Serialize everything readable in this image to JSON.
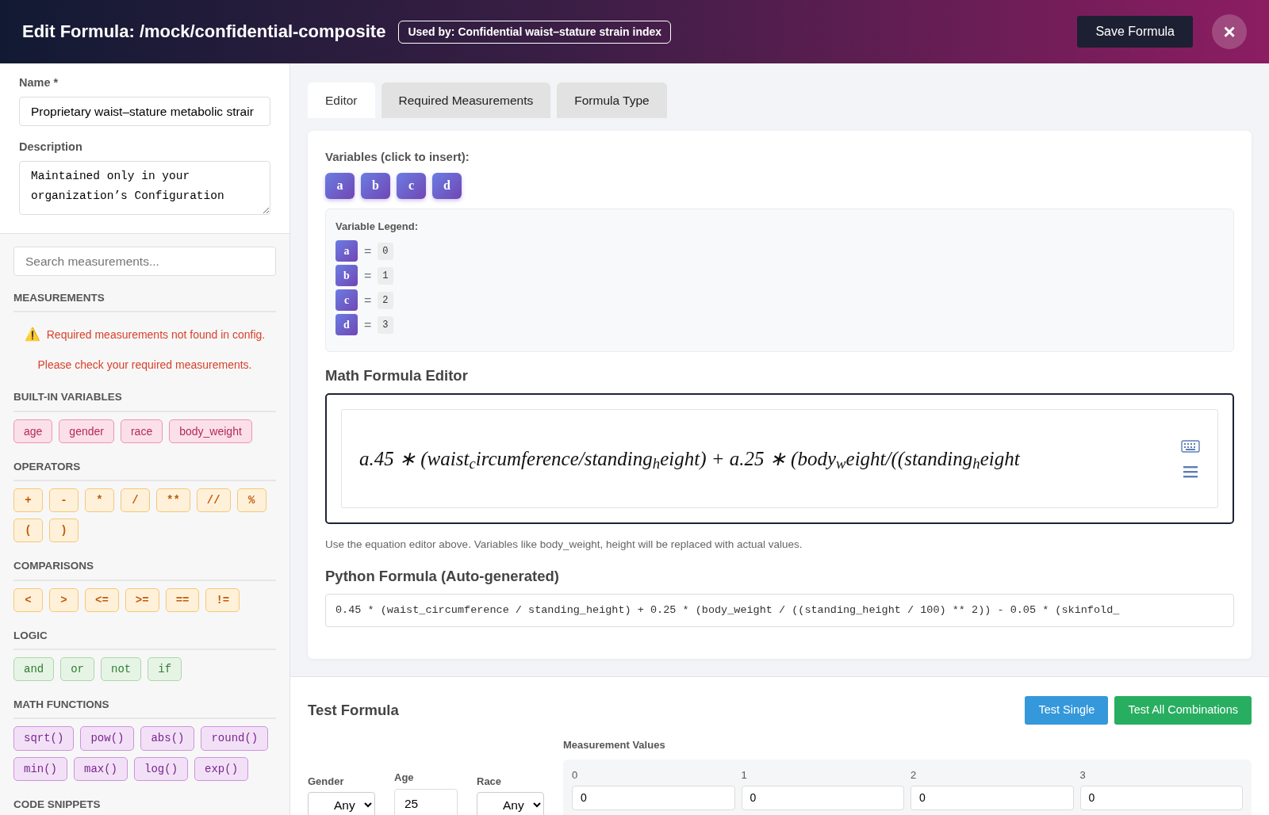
{
  "header": {
    "title": "Edit Formula: /mock/confidential-composite",
    "used_by": "Used by: Confidential waist–stature strain index",
    "save_button": "Save Formula",
    "close_button": "×"
  },
  "form": {
    "name": {
      "label": "Name *",
      "value": "Proprietary waist–stature metabolic strair"
    },
    "description": {
      "label": "Description",
      "value": "Maintained only in your organization’s Configuration"
    }
  },
  "sidebar": {
    "search_placeholder": "Search measurements...",
    "sections": [
      {
        "title": "MEASUREMENTS",
        "kind": "message",
        "warning_icon": "⚠️",
        "lines": [
          "Required measurements not found in config.",
          "Please check your required measurements."
        ]
      },
      {
        "title": "BUILT-IN VARIABLES",
        "kind": "builtin",
        "items": [
          "age",
          "gender",
          "race",
          "body_weight"
        ]
      },
      {
        "title": "OPERATORS",
        "kind": "operator",
        "items": [
          "+",
          "-",
          "*",
          "/",
          "**",
          "//",
          "%",
          "(",
          ")"
        ]
      },
      {
        "title": "COMPARISONS",
        "kind": "operator",
        "items": [
          "<",
          ">",
          "<=",
          ">=",
          "==",
          "!="
        ]
      },
      {
        "title": "LOGIC",
        "kind": "logic",
        "items": [
          "and",
          "or",
          "not",
          "if"
        ]
      },
      {
        "title": "MATH FUNCTIONS",
        "kind": "function",
        "items": [
          "sqrt()",
          "pow()",
          "abs()",
          "round()",
          "min()",
          "max()",
          "log()",
          "exp()"
        ]
      },
      {
        "title": "CODE SNIPPETS",
        "kind": "heading"
      }
    ]
  },
  "tabs": [
    {
      "label": "Editor",
      "selected": true
    },
    {
      "label": "Required Measurements",
      "selected": false
    },
    {
      "label": "Formula Type",
      "selected": false
    }
  ],
  "variables": {
    "label": "Variables (click to insert):",
    "buttons": [
      "a",
      "b",
      "c",
      "d"
    ],
    "legend_title": "Variable Legend:",
    "legend": [
      {
        "var": "a",
        "equals": "=",
        "value": "0"
      },
      {
        "var": "b",
        "equals": "=",
        "value": "1"
      },
      {
        "var": "c",
        "equals": "=",
        "value": "2"
      },
      {
        "var": "d",
        "equals": "=",
        "value": "3"
      }
    ]
  },
  "math_editor": {
    "title": "Math Formula Editor",
    "formula": "a.45 ∗ (waist$_{c}$ircumference/standing$_{h}$eight) + a.25 ∗ (body$_{w}$eight/((standing$_{h}$eight",
    "help": "Use the equation editor above. Variables like body_weight, height will be replaced with actual values."
  },
  "python": {
    "title": "Python Formula (Auto-generated)",
    "formula": "0.45 * (waist_circumference / standing_height) + 0.25 * (body_weight / ((standing_height / 100) ** 2)) - 0.05 * (skinfold_"
  },
  "test": {
    "title": "Test Formula",
    "buttons": [
      {
        "label": "Test Single",
        "kind": "primary"
      },
      {
        "label": "Test All Combinations",
        "kind": "success"
      }
    ],
    "fields": [
      {
        "label": "Age",
        "kind": "input",
        "value": "25"
      }
    ],
    "gender": {
      "label": "Gender",
      "value": "Any"
    },
    "race": {
      "label": "Race",
      "value": "Any"
    },
    "measurements_title": "Measurement Values",
    "measurements": [
      {
        "label": "0",
        "value": "0"
      },
      {
        "label": "1",
        "value": "0"
      },
      {
        "label": "2",
        "value": "0"
      },
      {
        "label": "3",
        "value": "0"
      }
    ]
  }
}
